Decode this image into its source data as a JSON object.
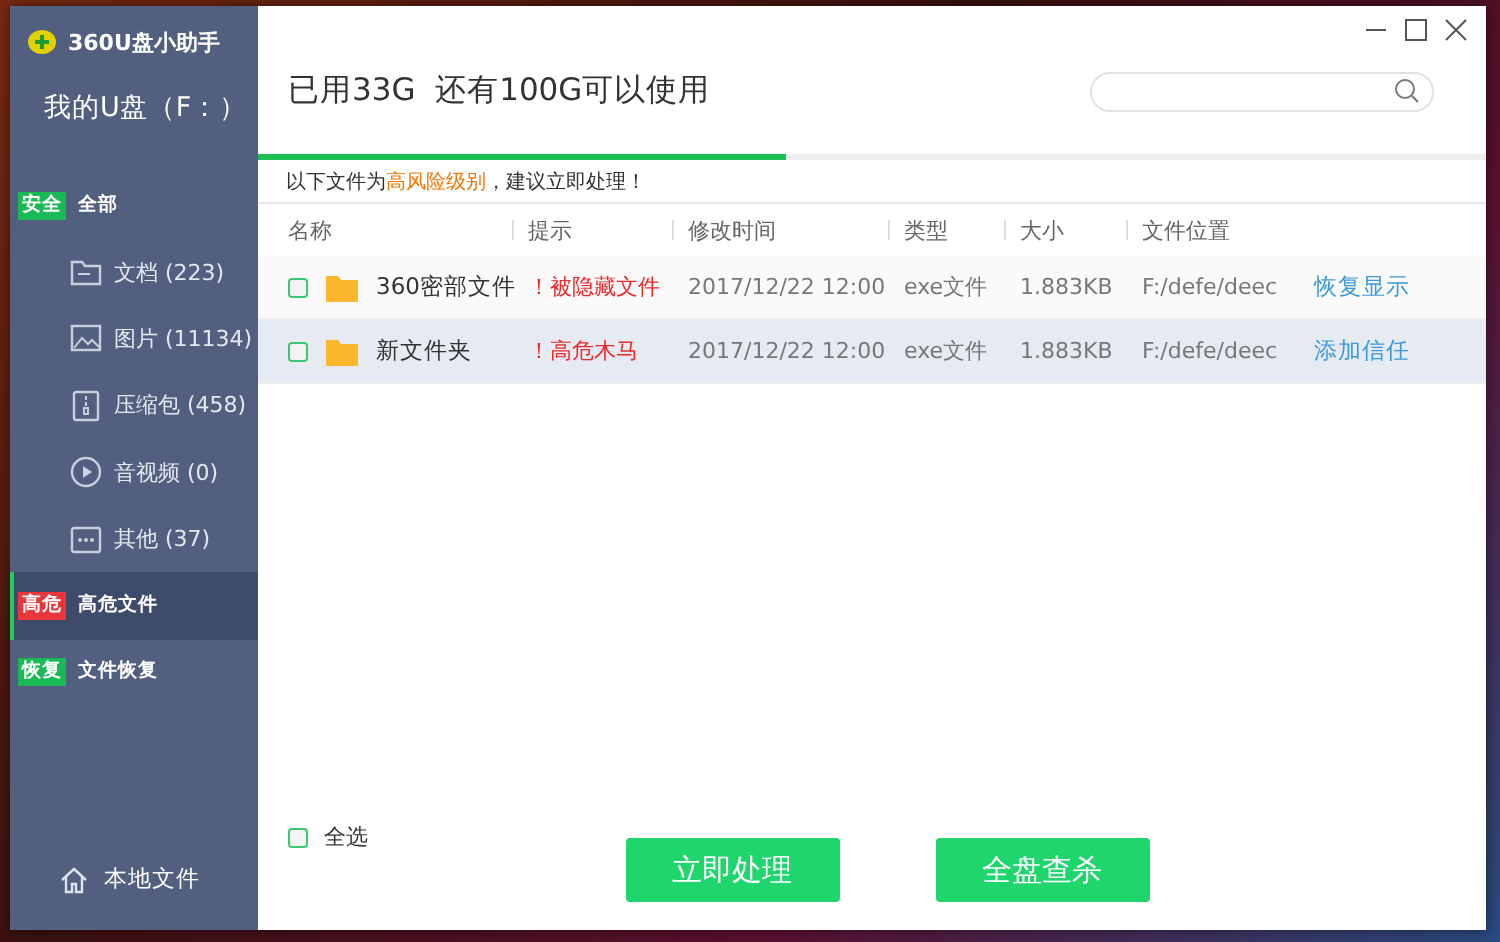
{
  "app": {
    "title": "360U盘小助手",
    "drive": "我的U盘（F：）"
  },
  "sidebar": {
    "items": [
      {
        "kind": "badge",
        "badge": "安全",
        "color": "#19b955",
        "label": "全部",
        "selected": false
      },
      {
        "kind": "sub",
        "label": "文档 (223)",
        "selected": false
      },
      {
        "kind": "sub",
        "label": "图片 (11134)",
        "selected": false
      },
      {
        "kind": "sub",
        "label": "压缩包 (458)",
        "selected": false
      },
      {
        "kind": "sub",
        "label": "音视频 (0)",
        "selected": false
      },
      {
        "kind": "sub",
        "label": "其他 (37)",
        "selected": false
      },
      {
        "kind": "badge",
        "badge": "高危",
        "color": "#e8363a",
        "label": "高危文件",
        "selected": true
      },
      {
        "kind": "badge",
        "badge": "恢复",
        "color": "#19b955",
        "label": "文件恢复",
        "selected": false
      }
    ],
    "footer": "本地文件"
  },
  "header": {
    "usage": "已用33G  还有100G可以使用",
    "usage_bar": {
      "level": 0.43
    }
  },
  "notice": [
    {
      "kind": "plain",
      "text": "以下文件为"
    },
    {
      "kind": "highlight",
      "text": "高风险级别"
    },
    {
      "kind": "plain",
      "text": "，建议立即处理！"
    }
  ],
  "table": {
    "columns": [
      "名称",
      "提示",
      "修改时间",
      "类型",
      "大小",
      "文件位置"
    ],
    "rows": [
      {
        "checked": false,
        "selected": false,
        "name": "360密部文件",
        "hint": "！被隐藏文件",
        "modified": "2017/12/22 12:00",
        "type": "exe文件",
        "size": "1.883KB",
        "location": "F:/defe/deec",
        "action": "恢复显示"
      },
      {
        "checked": false,
        "selected": true,
        "name": "新文件夹",
        "hint": "！高危木马",
        "modified": "2017/12/22 12:00",
        "type": "exe文件",
        "size": "1.883KB",
        "location": "F:/defe/deec",
        "action": "添加信任"
      }
    ]
  },
  "select_all": {
    "label": "全选",
    "checked": false
  },
  "buttons": [
    "立即处理",
    "全盘查杀"
  ]
}
